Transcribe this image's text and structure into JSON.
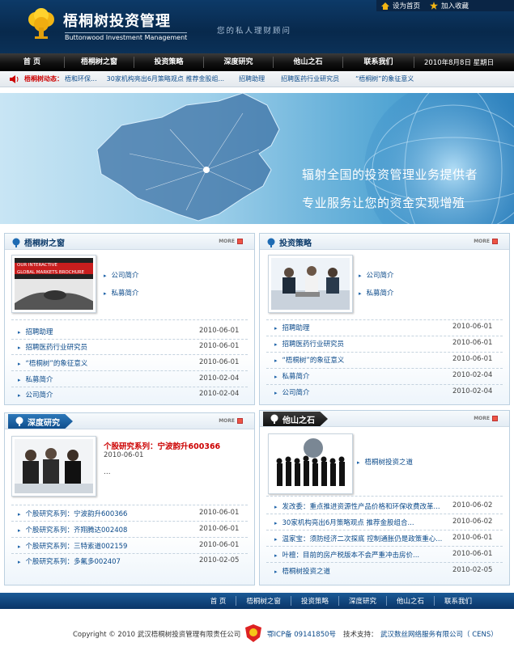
{
  "header": {
    "logo_cn": "梧桐树投资管理",
    "logo_en": "Buttonwood Investment Management",
    "slogan": "您的私人理财顾问",
    "set_home": "设为首页",
    "bookmark": "加入收藏"
  },
  "nav": {
    "items": [
      "首 页",
      "梧桐树之窗",
      "投资策略",
      "深度研究",
      "他山之石",
      "联系我们"
    ],
    "date": "2010年8月8日 星期日"
  },
  "ticker": {
    "label": "梧桐树动态：",
    "items": [
      "梧和环保...",
      "30家机构亮出6月策略观点 推荐金股组...",
      "招聘助理",
      "招聘医药行业研究员",
      "“梧桐树”的象征意义"
    ]
  },
  "banner": {
    "line1": "辐射全国的投资管理业务提供者",
    "line2": "专业服务让您的资金实现增殖",
    "brochure_line1": "OUR INTERACTIVE",
    "brochure_line2": "GLOBAL MARKETS BROCHURE"
  },
  "panels": {
    "window": {
      "title": "梧桐树之窗",
      "more": "MORE",
      "top_links": [
        "公司简介",
        "私募简介"
      ],
      "list": [
        {
          "title": "招聘助理",
          "date": "2010-06-01"
        },
        {
          "title": "招聘医药行业研究员",
          "date": "2010-06-01"
        },
        {
          "title": "“梧桐树”的象征意义",
          "date": "2010-06-01"
        },
        {
          "title": "私募简介",
          "date": "2010-02-04"
        },
        {
          "title": "公司简介",
          "date": "2010-02-04"
        }
      ]
    },
    "strategy": {
      "title": "投资策略",
      "more": "MORE",
      "top_links": [
        "公司简介",
        "私募简介"
      ],
      "list": [
        {
          "title": "招聘助理",
          "date": "2010-06-01"
        },
        {
          "title": "招聘医药行业研究员",
          "date": "2010-06-01"
        },
        {
          "title": "“梧桐树”的象征意义",
          "date": "2010-06-01"
        },
        {
          "title": "私募简介",
          "date": "2010-02-04"
        },
        {
          "title": "公司简介",
          "date": "2010-02-04"
        }
      ]
    },
    "research": {
      "title": "深度研究",
      "more": "MORE",
      "feature_title": "个股研究系列：宁波韵升600366",
      "feature_date": "2010-06-01",
      "feature_ellipsis": "...",
      "list": [
        {
          "title": "个股研究系列：宁波韵升600366",
          "date": "2010-06-01"
        },
        {
          "title": "个股研究系列：齐翔腾达002408",
          "date": "2010-06-01"
        },
        {
          "title": "个股研究系列：三特索道002159",
          "date": "2010-06-01"
        },
        {
          "title": "个股研究系列：多氟多002407",
          "date": "2010-02-05"
        }
      ]
    },
    "others": {
      "title": "他山之石",
      "more": "MORE",
      "top_link": "梧桐树投资之道",
      "list": [
        {
          "title": "发改委：重点推进资源性产品价格和环保收费改革...",
          "date": "2010-06-02"
        },
        {
          "title": "30家机构亮出6月策略观点 推荐金股组合...",
          "date": "2010-06-02"
        },
        {
          "title": "温家宝：须防经济二次探底 控制通胀仍是政策重心...",
          "date": "2010-06-01"
        },
        {
          "title": "叶檀：目前的房产税版本不会严重冲击房价...",
          "date": "2010-06-01"
        },
        {
          "title": "梧桐树投资之道",
          "date": "2010-02-05"
        }
      ]
    }
  },
  "footer": {
    "nav": [
      "首 页",
      "梧桐树之窗",
      "投资策略",
      "深度研究",
      "他山之石",
      "联系我们"
    ],
    "copyright": "Copyright © 2010 武汉梧桐树投资管理有限责任公司",
    "icp": "鄂ICP备 09141850号",
    "support_label": "技术支持：",
    "support": "武汉数丝网络服务有限公司（ CENS）"
  },
  "colors": {
    "brand_blue": "#0b3a6a",
    "accent_red": "#cc0000",
    "link_blue": "#0b4a8a"
  }
}
